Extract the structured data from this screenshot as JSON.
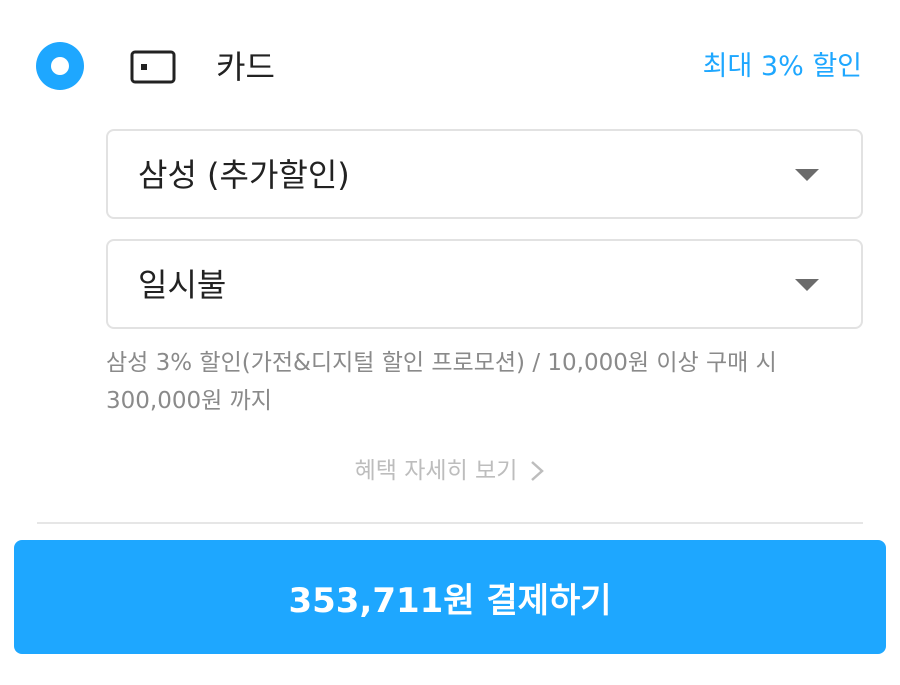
{
  "payment_method": {
    "label": "카드",
    "icon": "card-icon",
    "selected": true,
    "max_discount": "최대 3% 할인"
  },
  "card_select": {
    "value": "삼성 (추가할인)"
  },
  "installment_select": {
    "value": "일시불"
  },
  "promotion": {
    "line1": "삼성 3% 할인(가전&디지털 할인 프로모션) / 10,000원 이상 구매 시",
    "line2": "300,000원 까지"
  },
  "benefit_link": {
    "label": "혜택 자세히 보기"
  },
  "pay_button": {
    "label": "353,711원 결제하기"
  },
  "colors": {
    "accent": "#1ea7ff",
    "muted_text": "#8a8a8a",
    "border": "#e2e2e2"
  }
}
